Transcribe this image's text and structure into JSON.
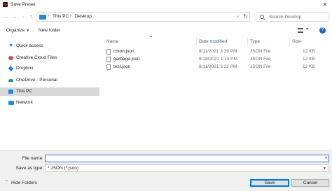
{
  "window": {
    "title": "Save Preset",
    "app_icon_text": "Ae"
  },
  "address": {
    "crumbs": [
      "This PC",
      "Desktop"
    ]
  },
  "search": {
    "placeholder": "Search Desktop"
  },
  "toolbar": {
    "organize_label": "Organize",
    "new_folder_label": "New folder"
  },
  "sidebar": {
    "items": [
      {
        "label": "Quick access",
        "icon": "star-icon"
      },
      {
        "label": "Creative Cloud Files",
        "icon": "creative-cloud-icon"
      },
      {
        "label": "Dropbox",
        "icon": "dropbox-icon"
      },
      {
        "label": "OneDrive - Personal",
        "icon": "onedrive-icon"
      },
      {
        "label": "This PC",
        "icon": "computer-icon",
        "selected": true
      },
      {
        "label": "Network",
        "icon": "network-icon"
      }
    ]
  },
  "columns": {
    "name": "Name",
    "date": "Date modified",
    "type": "Type",
    "size": "Size"
  },
  "files": [
    {
      "name": "cmon.json",
      "date": "8/11/2021 3:39 PM",
      "type": "JSON File",
      "size": "12 KB"
    },
    {
      "name": "garbage.json",
      "date": "8/18/2021 1:13 PM",
      "type": "JSON File",
      "size": "12 KB"
    },
    {
      "name": "test.json",
      "date": "8/11/2021 3:22 PM",
      "type": "JSON File",
      "size": "12 KB"
    }
  ],
  "footer": {
    "file_name_label": "File name:",
    "file_name_value": "",
    "save_as_type_label": "Save as type:",
    "save_as_type_value": "*.JSON (*.json)",
    "hide_folders_label": "Hide Folders",
    "save_label": "Save",
    "cancel_label": "Cancel"
  },
  "colors": {
    "accent": "#0078d7",
    "selected_bg": "#d9d9d9",
    "footer_bg": "#f0f0f0"
  }
}
